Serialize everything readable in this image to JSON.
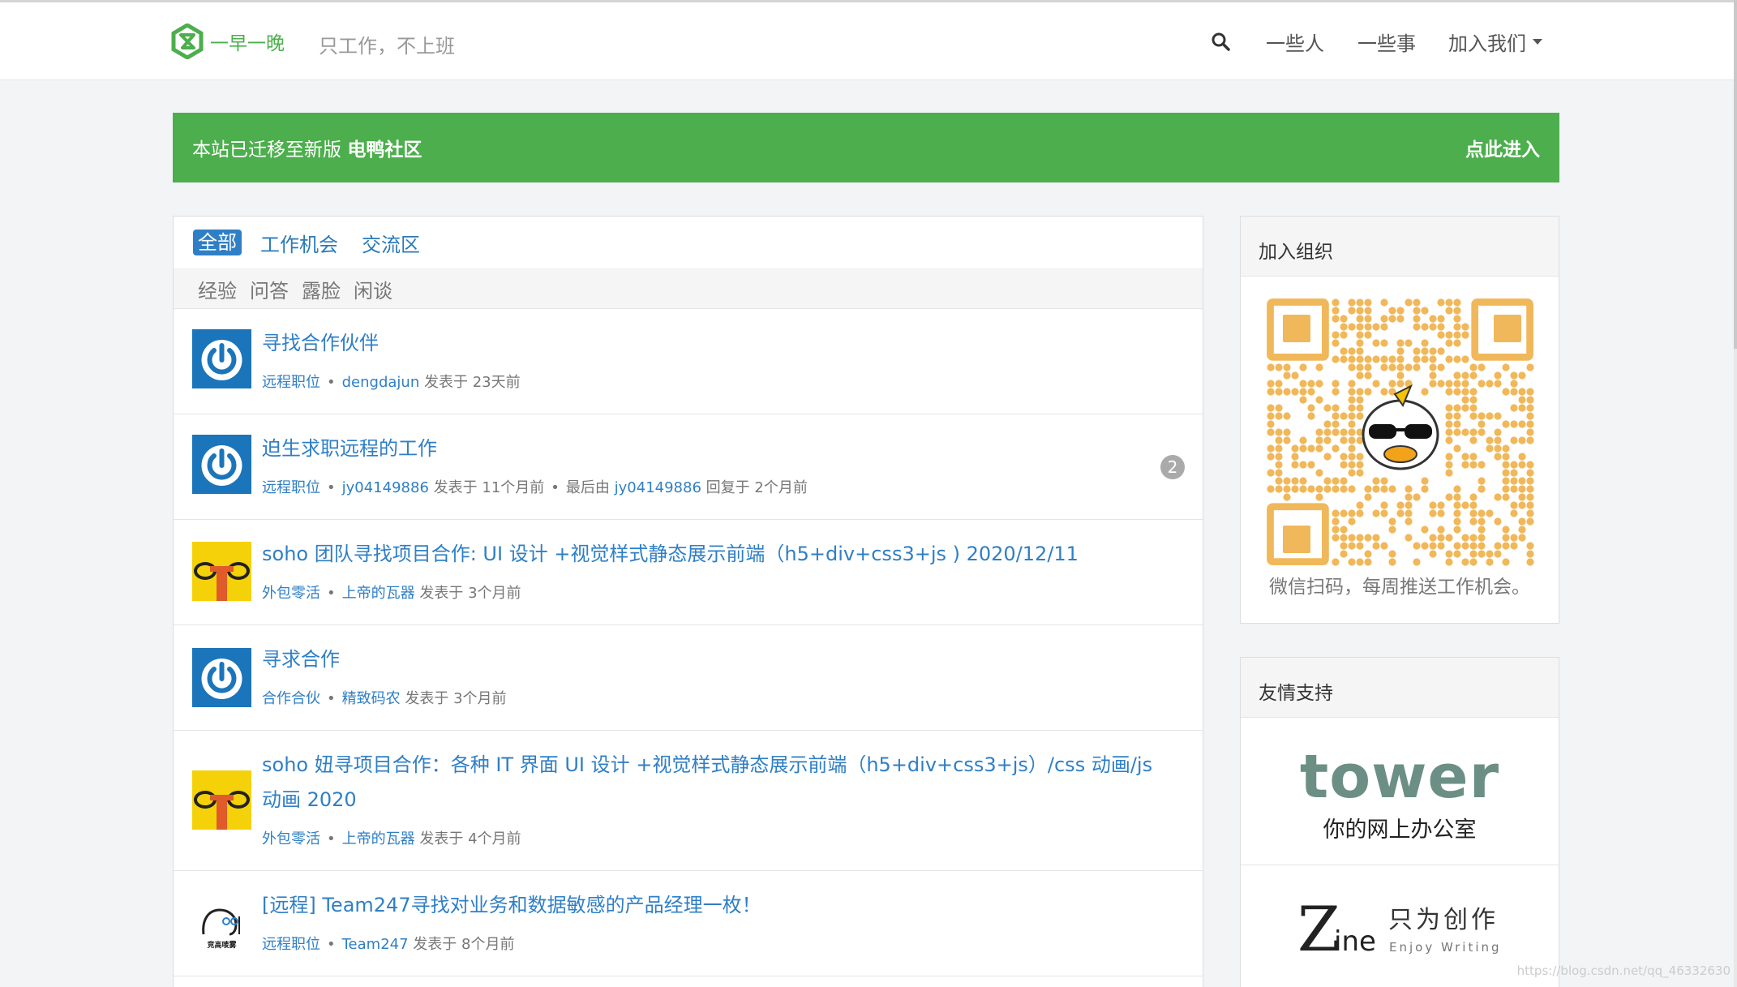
{
  "header": {
    "brand_name": "一早一晚",
    "slogan": "只工作，不上班",
    "nav": [
      "一些人",
      "一些事",
      "加入我们"
    ]
  },
  "banner": {
    "text": "本站已迁移至新版",
    "highlight": "电鸭社区",
    "link": "点此进入"
  },
  "tabs": [
    "全部",
    "工作机会",
    "交流区"
  ],
  "subtabs": [
    "经验",
    "问答",
    "露脸",
    "闲谈"
  ],
  "topics": [
    {
      "title": "寻找合作伙伴",
      "category": "远程职位",
      "author": "dengdajun",
      "posted": "发表于 23天前",
      "avatar": "power-avatar"
    },
    {
      "title": "迫生求职远程的工作",
      "category": "远程职位",
      "author": "jy04149886",
      "posted": "发表于 11个月前",
      "last_prefix": "最后由",
      "last_user": "jy04149886",
      "last_reply": "回复于 2个月前",
      "replies": "2",
      "avatar": "power-avatar"
    },
    {
      "title": "soho 团队寻找项目合作: UI 设计 +视觉样式静态展示前端（h5+div+css3+js ) 2020/12/11",
      "category": "外包零活",
      "author": "上帝的瓦器",
      "posted": "发表于 3个月前",
      "avatar": "cartoon-avatar"
    },
    {
      "title": "寻求合作",
      "category": "合作合伙",
      "author": "精致码农",
      "posted": "发表于 3个月前",
      "avatar": "power-avatar"
    },
    {
      "title": "soho 妞寻项目合作：各种 IT 界面 UI 设计 +视觉样式静态展示前端（h5+div+css3+js）/css 动画/js 动画 2020",
      "category": "外包零活",
      "author": "上帝的瓦器",
      "posted": "发表于 4个月前",
      "avatar": "cartoon-avatar"
    },
    {
      "title": "[远程] Team247寻找对业务和数据敏感的产品经理一枚！",
      "category": "远程职位",
      "author": "Team247",
      "posted": "发表于 8个月前",
      "avatar": "team247-avatar"
    }
  ],
  "sidebar": {
    "join_title": "加入组织",
    "qr_caption": "微信扫码，每周推送工作机会。",
    "sponsors_title": "友情支持",
    "tower_word": "tower",
    "tower_sub": "你的网上办公室",
    "zine_z": "Z",
    "zine_ine": "ine",
    "zine_cn": "只为创作",
    "zine_en": "Enjoy Writing",
    "team247_logo_text": "竞高唛雾"
  },
  "watermark": "https://blog.csdn.net/qq_46332630",
  "colors": {
    "brand_green": "#4cae4c",
    "link_blue": "#2f7fc6",
    "qr_orange": "#f0b85a",
    "tower_teal": "#6b8f84"
  }
}
